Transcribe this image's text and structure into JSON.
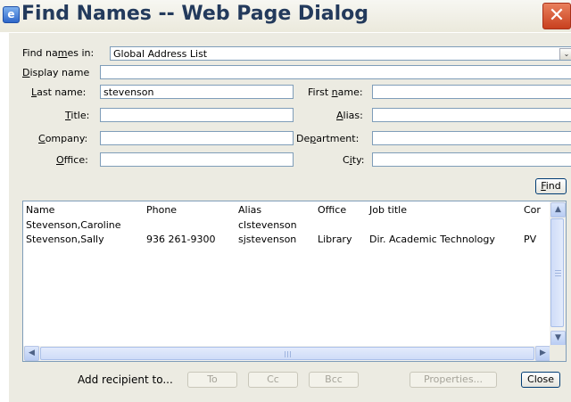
{
  "window": {
    "title": "Find Names -- Web Page Dialog",
    "close_glyph": "✕",
    "app_icon_glyph": "e"
  },
  "search": {
    "find_in": {
      "label_pre": "Find na",
      "label_key": "m",
      "label_post": "es in:",
      "value": "Global Address List",
      "arrow": "⌄"
    },
    "display_name": {
      "label_key": "D",
      "label_post": "isplay name",
      "value": ""
    },
    "last_name": {
      "label_key": "L",
      "label_post": "ast name:",
      "value": "stevenson"
    },
    "first_name": {
      "label_pre": "First ",
      "label_key": "n",
      "label_post": "ame:",
      "value": ""
    },
    "title": {
      "label_key": "T",
      "label_post": "itle:",
      "value": ""
    },
    "alias": {
      "label_key": "A",
      "label_post": "lias:",
      "value": ""
    },
    "company": {
      "label_key": "C",
      "label_post": "ompany:",
      "value": ""
    },
    "department": {
      "label_pre": "De",
      "label_key": "p",
      "label_post": "artment:",
      "value": ""
    },
    "office": {
      "label_key": "O",
      "label_post": "ffice:",
      "value": ""
    },
    "city": {
      "label_pre": "C",
      "label_key": "i",
      "label_post": "ty:",
      "value": ""
    },
    "find_button": {
      "label_key": "F",
      "label_post": "ind"
    }
  },
  "results": {
    "columns": [
      "Name",
      "Phone",
      "Alias",
      "Office",
      "Job title",
      "Cor"
    ],
    "rows": [
      {
        "name": "Stevenson,Caroline",
        "phone": "",
        "alias": "clstevenson",
        "office": "",
        "job_title": "",
        "company": ""
      },
      {
        "name": "Stevenson,Sally",
        "phone": "936 261-9300",
        "alias": "sjstevenson",
        "office": "Library",
        "job_title": "Dir. Academic Technology",
        "company": "PV"
      }
    ],
    "scroll": {
      "up": "▲",
      "down": "▼",
      "left": "◀",
      "right": "▶"
    }
  },
  "footer": {
    "add_recipient_label": "Add recipient to...",
    "to": "To",
    "cc": "Cc",
    "bcc": "Bcc",
    "properties": "Properties...",
    "close": "Close"
  }
}
